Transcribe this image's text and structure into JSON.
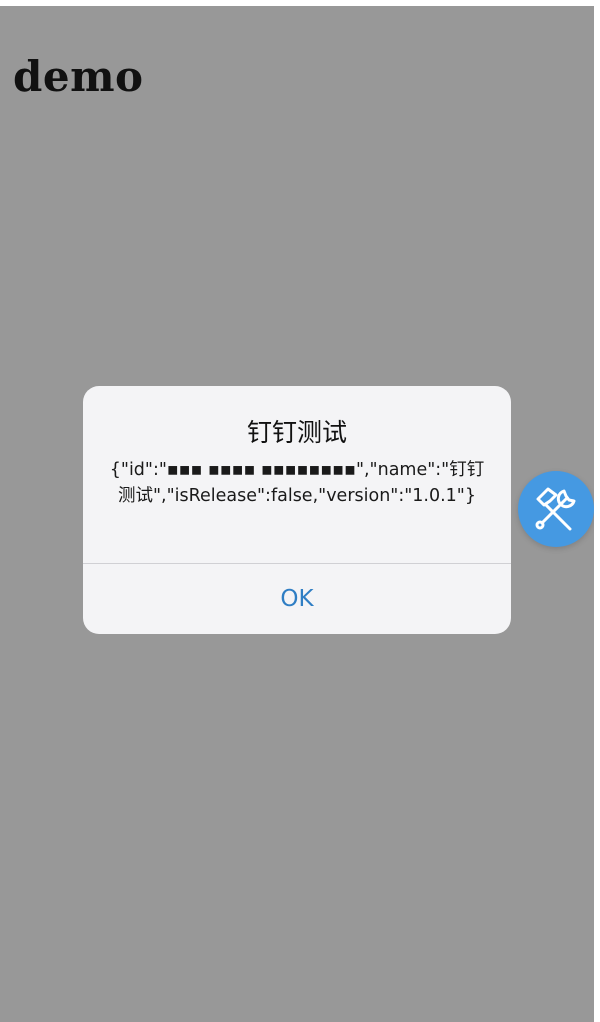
{
  "page": {
    "title": "demo"
  },
  "alert": {
    "title": "钉钉测试",
    "message": "{\"id\":\"▪▪▪ ▪▪▪▪ ▪▪▪▪▪▪▪▪\",\"name\":\"钉钉测试\",\"isRelease\":false,\"version\":\"1.0.1\"}",
    "ok_label": "OK"
  },
  "floating_button": {
    "icon": "wrench-hammer-icon",
    "color": "#4599e2"
  },
  "colors": {
    "backdrop": "#989898",
    "alert_background": "#f4f4f6",
    "button_text": "#2f7ec4"
  }
}
